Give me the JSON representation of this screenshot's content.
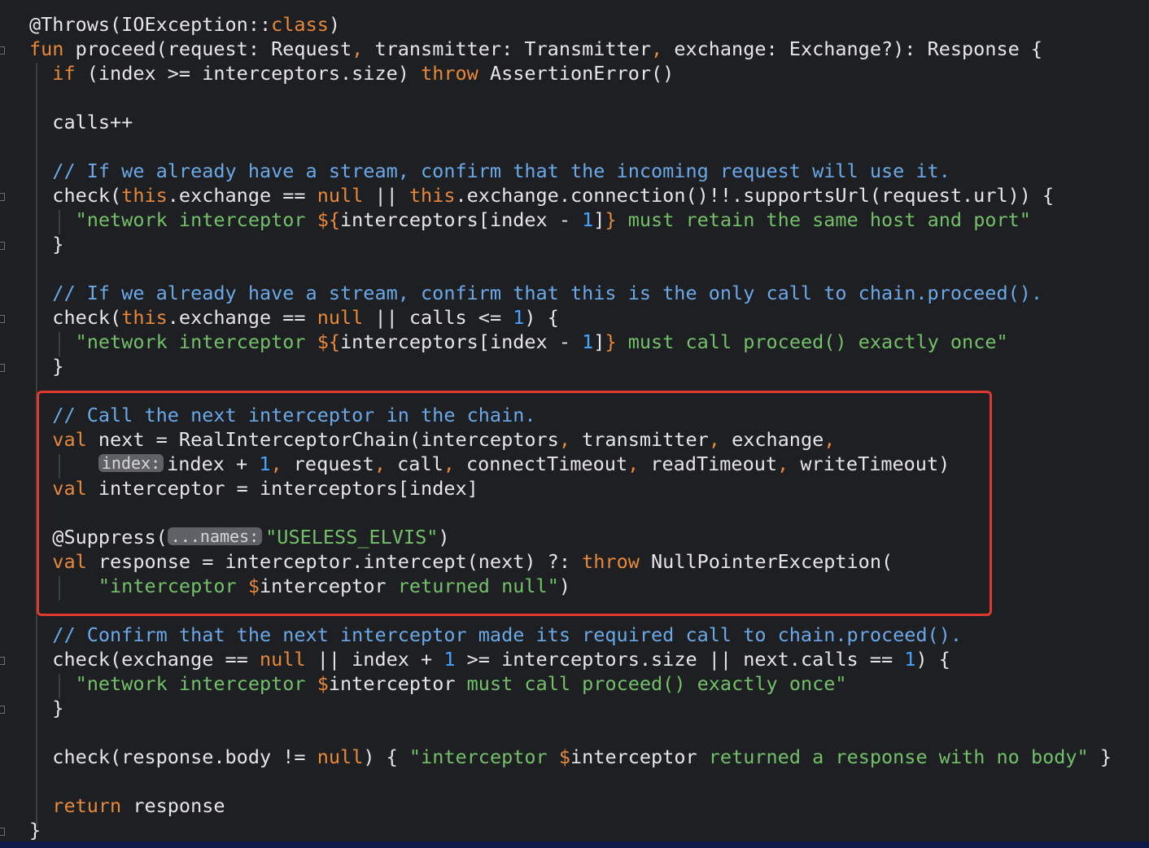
{
  "editor": {
    "lines": [
      [
        {
          "t": "@Throws(IOException::",
          "c": "ann"
        },
        {
          "t": "class",
          "c": "kw"
        },
        {
          "t": ")",
          "c": "def"
        }
      ],
      [
        {
          "t": "fun ",
          "c": "kw"
        },
        {
          "t": "proceed(request: Request",
          "c": "def"
        },
        {
          "t": ", ",
          "c": "kw"
        },
        {
          "t": "transmitter: Transmitter",
          "c": "def"
        },
        {
          "t": ", ",
          "c": "kw"
        },
        {
          "t": "exchange: Exchange?): Response {",
          "c": "def"
        }
      ],
      [
        {
          "t": "  if ",
          "c": "kw"
        },
        {
          "t": "(index >= interceptors.size) ",
          "c": "def"
        },
        {
          "t": "throw ",
          "c": "kw"
        },
        {
          "t": "AssertionError()",
          "c": "def"
        }
      ],
      [],
      [
        {
          "t": "  calls++",
          "c": "def"
        }
      ],
      [],
      [
        {
          "t": "  // If we already have a stream, confirm that the incoming request will use it.",
          "c": "cm"
        }
      ],
      [
        {
          "t": "  check(",
          "c": "def"
        },
        {
          "t": "this",
          "c": "kw"
        },
        {
          "t": ".exchange == ",
          "c": "def"
        },
        {
          "t": "null",
          "c": "kw"
        },
        {
          "t": " || ",
          "c": "def"
        },
        {
          "t": "this",
          "c": "kw"
        },
        {
          "t": ".exchange.connection()!!.supportsUrl(request.url)) {",
          "c": "def"
        }
      ],
      [
        {
          "t": "    \"network interceptor ",
          "c": "str"
        },
        {
          "t": "${",
          "c": "kw"
        },
        {
          "t": "interceptors[index - ",
          "c": "def"
        },
        {
          "t": "1",
          "c": "num"
        },
        {
          "t": "]",
          "c": "def"
        },
        {
          "t": "}",
          "c": "kw"
        },
        {
          "t": " must retain the same host and port\"",
          "c": "str"
        }
      ],
      [
        {
          "t": "  }",
          "c": "def"
        }
      ],
      [],
      [
        {
          "t": "  // If we already have a stream, confirm that this is the only call to chain.proceed().",
          "c": "cm"
        }
      ],
      [
        {
          "t": "  check(",
          "c": "def"
        },
        {
          "t": "this",
          "c": "kw"
        },
        {
          "t": ".exchange == ",
          "c": "def"
        },
        {
          "t": "null",
          "c": "kw"
        },
        {
          "t": " || calls <= ",
          "c": "def"
        },
        {
          "t": "1",
          "c": "num"
        },
        {
          "t": ") {",
          "c": "def"
        }
      ],
      [
        {
          "t": "    \"network interceptor ",
          "c": "str"
        },
        {
          "t": "${",
          "c": "kw"
        },
        {
          "t": "interceptors[index - ",
          "c": "def"
        },
        {
          "t": "1",
          "c": "num"
        },
        {
          "t": "]",
          "c": "def"
        },
        {
          "t": "}",
          "c": "kw"
        },
        {
          "t": " must call proceed() exactly once\"",
          "c": "str"
        }
      ],
      [
        {
          "t": "  }",
          "c": "def"
        }
      ],
      [],
      [
        {
          "t": "  // Call the next interceptor in the chain.",
          "c": "cm"
        }
      ],
      [
        {
          "t": "  val ",
          "c": "kw"
        },
        {
          "t": "next = RealInterceptorChain(interceptors",
          "c": "def"
        },
        {
          "t": ", ",
          "c": "kw"
        },
        {
          "t": "transmitter",
          "c": "def"
        },
        {
          "t": ", ",
          "c": "kw"
        },
        {
          "t": "exchange",
          "c": "def"
        },
        {
          "t": ",",
          "c": "kw"
        }
      ],
      [
        {
          "t": "      ",
          "c": "def"
        },
        {
          "h": "index:"
        },
        {
          "t": "index + ",
          "c": "def"
        },
        {
          "t": "1",
          "c": "num"
        },
        {
          "t": ", ",
          "c": "kw"
        },
        {
          "t": "request",
          "c": "def"
        },
        {
          "t": ", ",
          "c": "kw"
        },
        {
          "t": "call",
          "c": "def"
        },
        {
          "t": ", ",
          "c": "kw"
        },
        {
          "t": "connectTimeout",
          "c": "def"
        },
        {
          "t": ", ",
          "c": "kw"
        },
        {
          "t": "readTimeout",
          "c": "def"
        },
        {
          "t": ", ",
          "c": "kw"
        },
        {
          "t": "writeTimeout)",
          "c": "def"
        }
      ],
      [
        {
          "t": "  val ",
          "c": "kw"
        },
        {
          "t": "interceptor = interceptors[index]",
          "c": "def"
        }
      ],
      [],
      [
        {
          "t": "  @Suppress(",
          "c": "ann"
        },
        {
          "h": "...names:"
        },
        {
          "t": "\"USELESS_ELVIS\"",
          "c": "str"
        },
        {
          "t": ")",
          "c": "def"
        }
      ],
      [
        {
          "t": "  val ",
          "c": "kw"
        },
        {
          "t": "response = interceptor.intercept(next) ?: ",
          "c": "def"
        },
        {
          "t": "throw ",
          "c": "kw"
        },
        {
          "t": "NullPointerException(",
          "c": "def"
        }
      ],
      [
        {
          "t": "      \"interceptor ",
          "c": "str"
        },
        {
          "t": "$",
          "c": "kw"
        },
        {
          "t": "interceptor",
          "c": "def"
        },
        {
          "t": " returned null\"",
          "c": "str"
        },
        {
          "t": ")",
          "c": "def"
        }
      ],
      [],
      [
        {
          "t": "  // Confirm that the next interceptor made its required call to chain.proceed().",
          "c": "cm"
        }
      ],
      [
        {
          "t": "  check(exchange == ",
          "c": "def"
        },
        {
          "t": "null",
          "c": "kw"
        },
        {
          "t": " || index + ",
          "c": "def"
        },
        {
          "t": "1",
          "c": "num"
        },
        {
          "t": " >= interceptors.size || next.calls == ",
          "c": "def"
        },
        {
          "t": "1",
          "c": "num"
        },
        {
          "t": ") {",
          "c": "def"
        }
      ],
      [
        {
          "t": "    \"network interceptor ",
          "c": "str"
        },
        {
          "t": "$",
          "c": "kw"
        },
        {
          "t": "interceptor",
          "c": "def"
        },
        {
          "t": " must call proceed() exactly once\"",
          "c": "str"
        }
      ],
      [
        {
          "t": "  }",
          "c": "def"
        }
      ],
      [],
      [
        {
          "t": "  check(response.body != ",
          "c": "def"
        },
        {
          "t": "null",
          "c": "kw"
        },
        {
          "t": ") { ",
          "c": "def"
        },
        {
          "t": "\"interceptor ",
          "c": "str"
        },
        {
          "t": "$",
          "c": "kw"
        },
        {
          "t": "interceptor",
          "c": "def"
        },
        {
          "t": " returned a response with no body\"",
          "c": "str"
        },
        {
          "t": " }",
          "c": "def"
        }
      ],
      [],
      [
        {
          "t": "  return ",
          "c": "kw"
        },
        {
          "t": "response",
          "c": "def"
        }
      ],
      [
        {
          "t": "}",
          "c": "def"
        }
      ]
    ]
  },
  "colors": {
    "background": "#1e1f22",
    "keyword": "#e8883a",
    "comment": "#6aa8e8",
    "string": "#74c06a",
    "number": "#46a4ff",
    "highlight_border": "#e03a30"
  }
}
